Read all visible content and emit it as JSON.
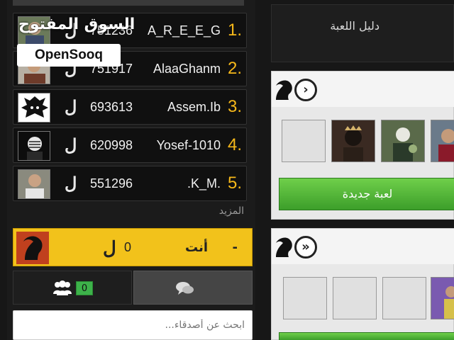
{
  "leaderboard": {
    "rows": [
      {
        "rank": "1.",
        "name": "A_R_E_E_G",
        "score": "751236",
        "coin": "ل"
      },
      {
        "rank": "2.",
        "name": "AlaaGhanm",
        "score": "751917",
        "coin": "ل"
      },
      {
        "rank": "3.",
        "name": "Assem.Ib",
        "score": "693613",
        "coin": "ل"
      },
      {
        "rank": "4.",
        "name": "Yosef-1010",
        "score": "620998",
        "coin": "ل"
      },
      {
        "rank": "5.",
        "name": ".K_M.",
        "score": "551296",
        "coin": "ل"
      }
    ],
    "more_label": "المزيد"
  },
  "you": {
    "label": "أنت",
    "dash": "-",
    "score": "0",
    "coin": "ل"
  },
  "tabs": {
    "friends_count": "0"
  },
  "search": {
    "placeholder": "ابحث عن أصدقاء..."
  },
  "right": {
    "guide_label": "دليل اللعبة",
    "card1": {
      "nav": "›",
      "new_game_label": "لعبة جديدة"
    },
    "card2": {
      "nav": "»"
    }
  },
  "watermark": {
    "arabic": "السوق المفتوح",
    "brand": "OpenSooq"
  },
  "colors": {
    "accent": "#f6b81a",
    "you_bg": "#f2c21b",
    "green": "#3db24a"
  }
}
